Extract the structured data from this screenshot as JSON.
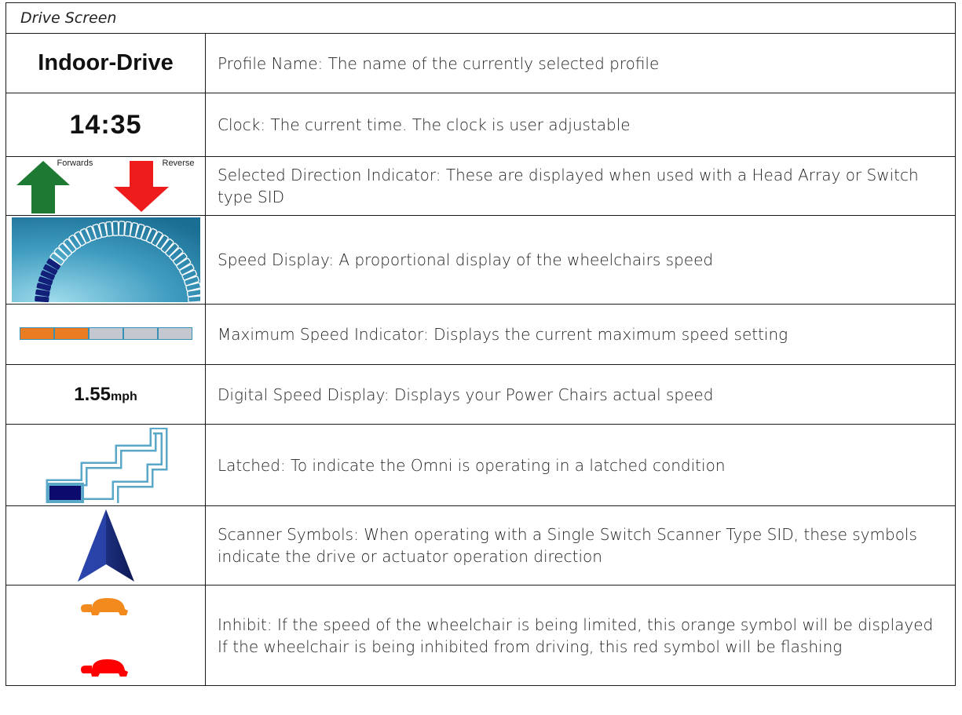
{
  "header": {
    "title": "Drive Screen"
  },
  "rows": [
    {
      "symbol_text": "Indoor-Drive",
      "description": "Profile Name: The name of the currently selected profile"
    },
    {
      "symbol_text": "14:35",
      "description": "Clock: The current time. The clock is user adjustable"
    },
    {
      "forwards_label": "Forwards",
      "reverse_label": "Reverse",
      "icon": "direction-arrows-icon",
      "description": "Selected Direction Indicator: These are displayed when used with a Head Array or Switch type SID"
    },
    {
      "icon": "speedometer-icon",
      "speed_level": 0.2,
      "description": "Speed Display: A proportional display of the wheelchairs speed"
    },
    {
      "icon": "max-speed-bar-icon",
      "segments_total": 5,
      "segments_lit": 2,
      "description": "Maximum Speed Indicator: Displays the current maximum speed setting"
    },
    {
      "speed_value": "1.55",
      "speed_unit": "mph",
      "description": "Digital Speed Display: Displays your Power Chairs actual speed"
    },
    {
      "icon": "latched-stairs-icon",
      "description": "Latched: To indicate the Omni is operating in a latched condition"
    },
    {
      "icon": "scanner-arrow-icon",
      "description": "Scanner Symbols: When operating with a Single Switch Scanner Type SID, these symbols indicate the drive or actuator operation direction"
    },
    {
      "icons": [
        "orange-turtle-icon",
        "red-turtle-icon"
      ],
      "description_line1": "Inhibit: If the speed of the wheelchair is being limited, this orange symbol will be displayed",
      "description_line2": "If the wheelchair is being inhibited from driving, this red symbol will be flashing"
    }
  ],
  "colors": {
    "forward_arrow": "#1e7a33",
    "reverse_arrow": "#ee1c1c",
    "segment_on": "#ea7d22",
    "segment_off": "#c3c7d0",
    "scanner_arrow": "#1b2f7a",
    "turtle_orange": "#f28a1e",
    "turtle_red": "#ff0000"
  }
}
